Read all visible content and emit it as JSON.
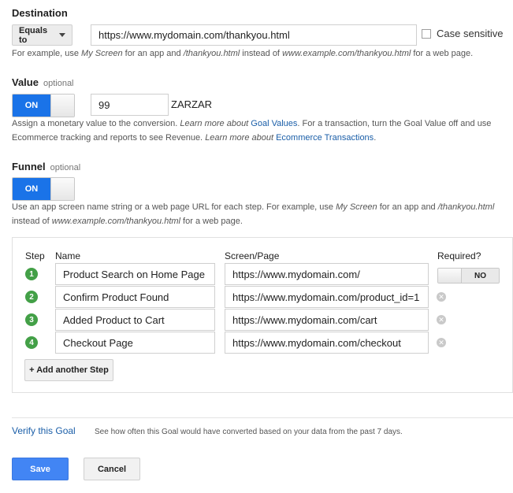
{
  "destination": {
    "title": "Destination",
    "match_type": "Equals to",
    "url_value": "https://www.mydomain.com/thankyou.html",
    "case_sensitive_label": "Case sensitive",
    "help": {
      "prefix": "For example, use ",
      "screen": "My Screen",
      "mid1": " for an app and ",
      "path": "/thankyou.html",
      "mid2": " instead of ",
      "full": "www.example.com/thankyou.html",
      "suffix": " for a web page."
    }
  },
  "value": {
    "title": "Value",
    "optional": "optional",
    "toggle_label": "ON",
    "amount": "99",
    "currency": "ZARZAR",
    "help": {
      "line1": "Assign a monetary value to the conversion. ",
      "learn1": "Learn more about ",
      "link1": "Goal Values",
      "line1b": ". For a transaction, turn the Goal Value off and use",
      "line2": "Ecommerce tracking and reports to see Revenue. ",
      "learn2": "Learn more about ",
      "link2": "Ecommerce Transactions",
      "end": "."
    }
  },
  "funnel": {
    "title": "Funnel",
    "optional": "optional",
    "toggle_label": "ON",
    "help": {
      "prefix": "Use an app screen name string or a web page URL for each step. For example, use ",
      "screen": "My Screen",
      "mid1": " for an app and ",
      "path": "/thankyou.html",
      "line2_prefix": "instead of ",
      "full": "www.example.com/thankyou.html",
      "suffix": " for a web page."
    },
    "headers": {
      "step": "Step",
      "name": "Name",
      "screen": "Screen/Page",
      "required": "Required?"
    },
    "steps": [
      {
        "num": "1",
        "name": "Product Search on Home Page",
        "page": "https://www.mydomain.com/"
      },
      {
        "num": "2",
        "name": "Confirm Product Found",
        "page": "https://www.mydomain.com/product_id=1"
      },
      {
        "num": "3",
        "name": "Added Product to Cart",
        "page": "https://www.mydomain.com/cart"
      },
      {
        "num": "4",
        "name": "Checkout Page",
        "page": "https://www.mydomain.com/checkout"
      }
    ],
    "required_toggle": "NO",
    "add_step_label": "+ Add another Step"
  },
  "verify": {
    "link": "Verify this Goal",
    "text": "See how often this Goal would have converted based on your data from the past 7 days."
  },
  "actions": {
    "save": "Save",
    "cancel": "Cancel"
  },
  "colors": {
    "primary": "#1a73e8",
    "step_badge": "#43a047",
    "link": "#1a5ea8"
  }
}
